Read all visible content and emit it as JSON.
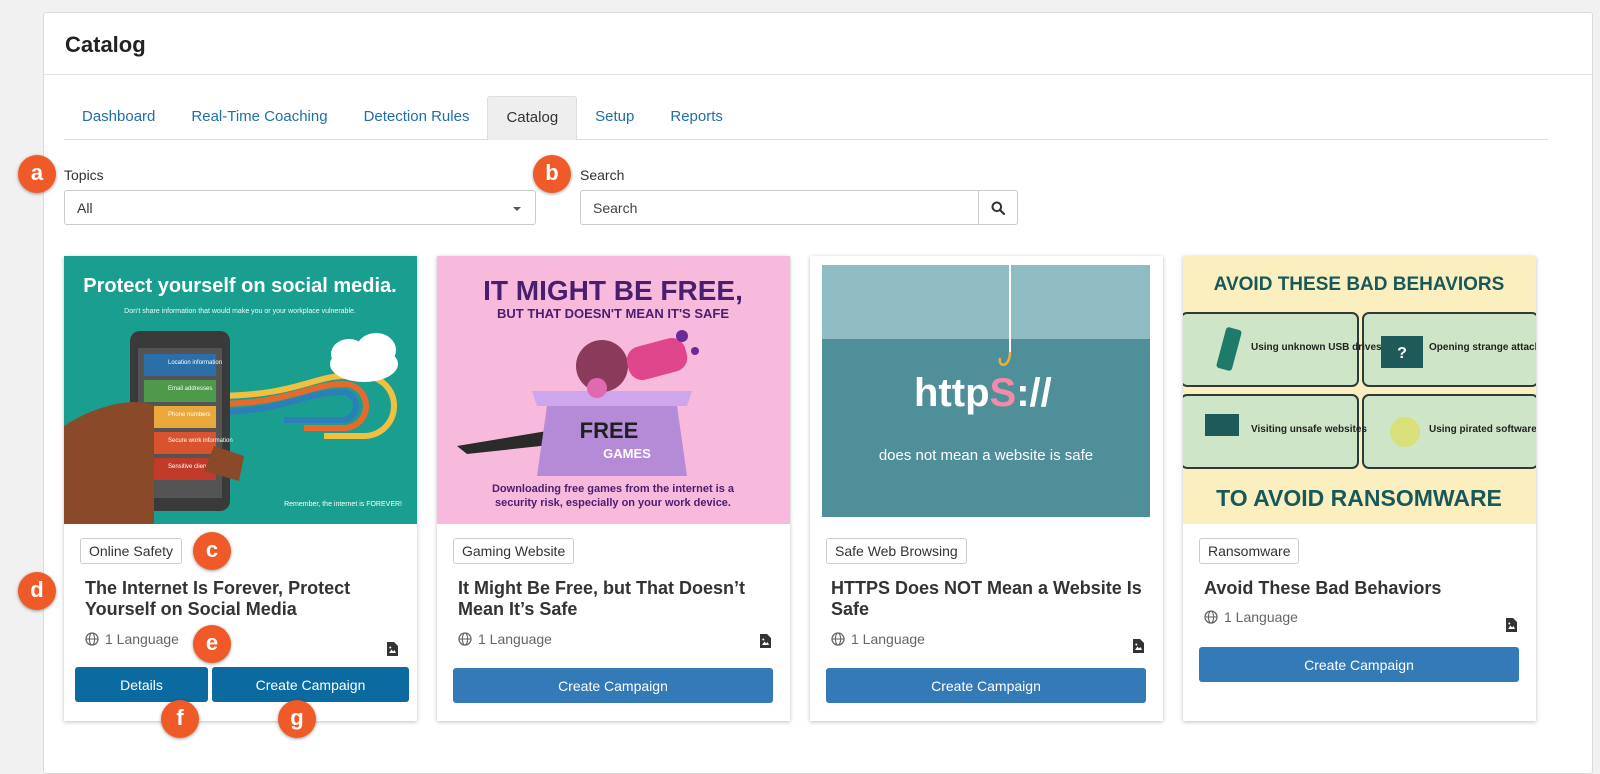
{
  "header": {
    "title": "Catalog"
  },
  "tabs": [
    {
      "label": "Dashboard"
    },
    {
      "label": "Real-Time Coaching"
    },
    {
      "label": "Detection Rules"
    },
    {
      "label": "Catalog",
      "active": true
    },
    {
      "label": "Setup"
    },
    {
      "label": "Reports"
    }
  ],
  "filters": {
    "topics_label": "Topics",
    "topics_value": "All",
    "search_label": "Search",
    "search_placeholder": "Search"
  },
  "cards": [
    {
      "tag": "Online Safety",
      "title": "The Internet Is Forever, Protect Yourself on Social Media",
      "languages": "1 Language",
      "details_label": "Details",
      "campaign_label": "Create Campaign",
      "image_text": {
        "headline": "Protect yourself on social media.",
        "sub": "Don't share information that would make you or your workplace vulnerable.",
        "items": [
          "Location information",
          "Email addresses",
          "Phone numbers",
          "Secure work information",
          "Sensitive client data"
        ],
        "footer": "Remember, the internet is FOREVER!"
      }
    },
    {
      "tag": "Gaming Website",
      "title": "It Might Be Free, but That Doesn’t Mean It’s Safe",
      "languages": "1 Language",
      "campaign_label": "Create Campaign",
      "image_text": {
        "headline": "IT MIGHT BE FREE,",
        "sub": "BUT THAT DOESN'T MEAN IT'S SAFE",
        "box1": "FREE",
        "box2": "GAMES",
        "footer1": "Downloading free games from the internet is a",
        "footer2": "security risk, especially on your work device."
      }
    },
    {
      "tag": "Safe Web Browsing",
      "title": "HTTPS Does NOT Mean a Website Is Safe",
      "languages": "1 Language",
      "campaign_label": "Create Campaign",
      "image_text": {
        "https_a": "http",
        "https_b": "S",
        "https_c": "://",
        "caption": "does not mean a website is safe"
      }
    },
    {
      "tag": "Ransomware",
      "title": "Avoid These Bad Behaviors",
      "languages": "1 Language",
      "campaign_label": "Create Campaign",
      "image_text": {
        "top": "AVOID THESE BAD BEHAVIORS",
        "bottom": "TO AVOID RANSOMWARE",
        "items": [
          "Using unknown USB drives",
          "Opening strange attachments",
          "Visiting unsafe websites",
          "Using pirated software"
        ]
      }
    }
  ],
  "callouts": [
    "a",
    "b",
    "c",
    "d",
    "e",
    "f",
    "g"
  ],
  "colors": {
    "link": "#1f6fa8",
    "primary_button": "#337ab7",
    "details_button": "#0b6aa0",
    "callout": "#f05a28",
    "card1_bg": "#1a9e8f",
    "card2_bg": "#f7b9dc",
    "card3_bg": "#4f8f9a",
    "card4_bg": "#fbefc0"
  }
}
